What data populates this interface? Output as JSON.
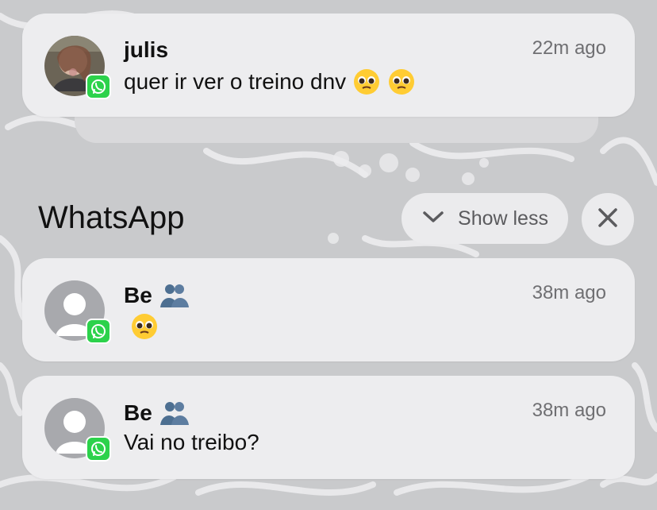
{
  "notifications_top": {
    "sender": "julis",
    "time": "22m ago",
    "message": "quer ir ver o treino dnv",
    "message_emoji": [
      "pleading-face",
      "pleading-face"
    ]
  },
  "group": {
    "title": "WhatsApp",
    "show_less_label": "Show less",
    "close_icon": "close-icon"
  },
  "group_notifications": [
    {
      "sender": "Be",
      "sender_emoji": "hugging-people",
      "time": "38m ago",
      "message": "",
      "message_emoji": [
        "pleading-face"
      ]
    },
    {
      "sender": "Be",
      "sender_emoji": "hugging-people",
      "time": "38m ago",
      "message": "Vai no treibo?",
      "message_emoji": []
    }
  ],
  "colors": {
    "whatsapp_green": "#2cd24b",
    "card_bg": "#ededef",
    "text_primary": "#111111",
    "text_secondary": "#6f6f72"
  }
}
